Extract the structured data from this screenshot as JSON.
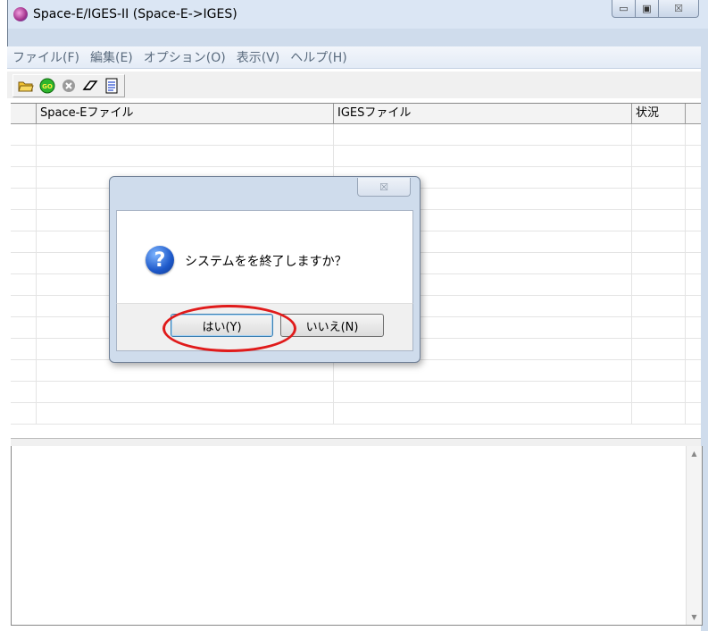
{
  "window": {
    "title": "Space-E/IGES-II (Space-E->IGES)",
    "app_icon": "app-logo-icon",
    "minimize_glyph": "▭",
    "maximize_glyph": "▣",
    "close_glyph": "☒"
  },
  "menu": {
    "items": [
      "ファイル(F)",
      "編集(E)",
      "オプション(O)",
      "表示(V)",
      "ヘルプ(H)"
    ]
  },
  "toolbar": {
    "buttons": [
      "open-folder-icon",
      "go-icon",
      "stop-icon",
      "eraser-icon",
      "document-icon"
    ]
  },
  "grid": {
    "columns": [
      "",
      "Space-Eファイル",
      "IGESファイル",
      "状況"
    ],
    "rows": []
  },
  "dialog": {
    "close_glyph": "☒",
    "icon": "question-icon",
    "message": "システムをを終了しますか？",
    "yes_label": "はい(Y)",
    "no_label": "いいえ(N)"
  },
  "annotation": {
    "highlight_color": "#e01b1b"
  }
}
